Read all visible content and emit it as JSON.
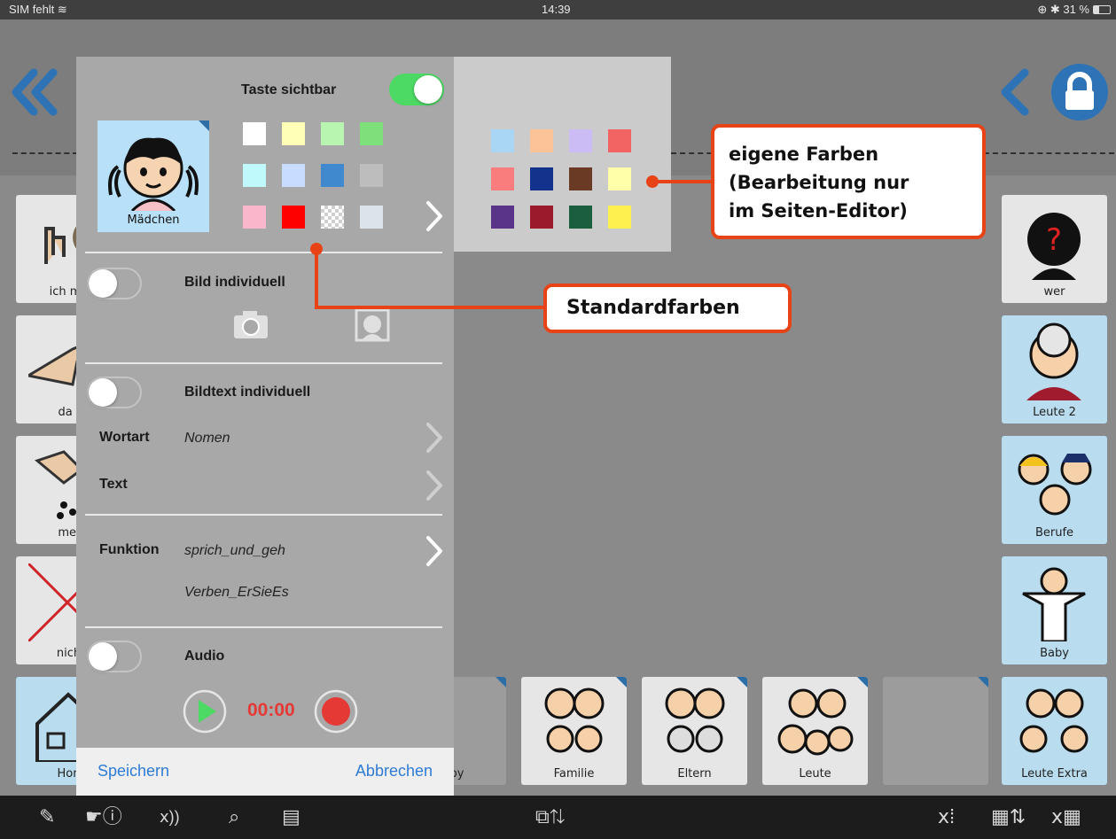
{
  "statusbar": {
    "carrier": "SIM fehlt",
    "time": "14:39",
    "battery": "31 %"
  },
  "grid": {
    "left_labels": [
      "ich mö",
      "da i",
      "mel",
      "nich",
      "Hon"
    ],
    "right_labels": [
      "wer",
      "Leute 2",
      "Berufe",
      "Baby",
      "Leute Extra"
    ],
    "bottom_labels": [
      "aby",
      "Familie",
      "Eltern",
      "Leute"
    ]
  },
  "panel": {
    "visible_label": "Taste sichtbar",
    "visible_on": true,
    "symbol_label": "Mädchen",
    "standard_colors": [
      "#ffffff",
      "#ffffb8",
      "#b8f5b0",
      "#7ee07a",
      "#bff9fb",
      "#c7dcff",
      "#4189cf",
      "#bdbdbd",
      "#f9b7cc",
      "#ff0000",
      "transparent",
      "#dde3ea"
    ],
    "image_toggle_label": "Bild individuell",
    "image_toggle_on": false,
    "imagetext_toggle_label": "Bildtext individuell",
    "imagetext_toggle_on": false,
    "wordtype_label": "Wortart",
    "wordtype_value": "Nomen",
    "text_label": "Text",
    "function_label": "Funktion",
    "function_value": "sprich_und_geh",
    "function_value2": "Verben_ErSieEs",
    "audio_label": "Audio",
    "audio_on": false,
    "audio_time": "00:00",
    "save_label": "Speichern",
    "cancel_label": "Abbrechen"
  },
  "own_colors": [
    "#a9d6f5",
    "#fcc496",
    "#cbbcf5",
    "#f26363",
    "#fa7d7d",
    "#12328c",
    "#6b3a24",
    "#ffffaa",
    "#5a3489",
    "#9b1b2d",
    "#195f3d",
    "#fdf04f"
  ],
  "callouts": {
    "own_colors": "eigene Farben\n(Bearbeitung nur\nim Seiten-Editor)",
    "standard_colors": "Standardfarben"
  },
  "colors": {
    "accent_orange": "#e84317",
    "ios_blue": "#2e7bd6",
    "toggle_green": "#4cd964",
    "record_red": "#e53935"
  }
}
